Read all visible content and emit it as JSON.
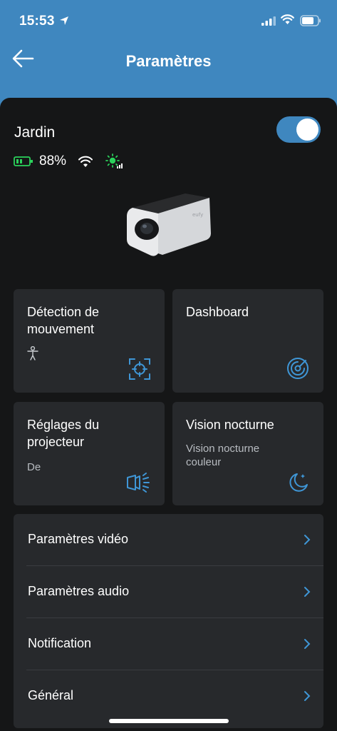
{
  "status_bar": {
    "time": "15:53"
  },
  "header": {
    "title": "Paramètres"
  },
  "device": {
    "name": "Jardin",
    "battery": "88%",
    "enabled": true
  },
  "tiles": [
    {
      "title": "Détection de mouvement",
      "subtitle": "",
      "icon": "motion-detection-icon"
    },
    {
      "title": "Dashboard",
      "subtitle": "",
      "icon": "dashboard-radar-icon"
    },
    {
      "title": "Réglages du projecteur",
      "subtitle": "De",
      "icon": "spotlight-icon"
    },
    {
      "title": "Vision nocturne",
      "subtitle": "Vision nocturne couleur",
      "icon": "night-moon-icon"
    }
  ],
  "menu": [
    {
      "label": "Paramètres vidéo"
    },
    {
      "label": "Paramètres audio"
    },
    {
      "label": "Notification"
    },
    {
      "label": "Général"
    }
  ],
  "colors": {
    "accent": "#3f87bf",
    "sheet": "#151617",
    "tile": "#27292c",
    "icon_blue": "#3f96d6",
    "battery_green": "#2bd15b"
  }
}
